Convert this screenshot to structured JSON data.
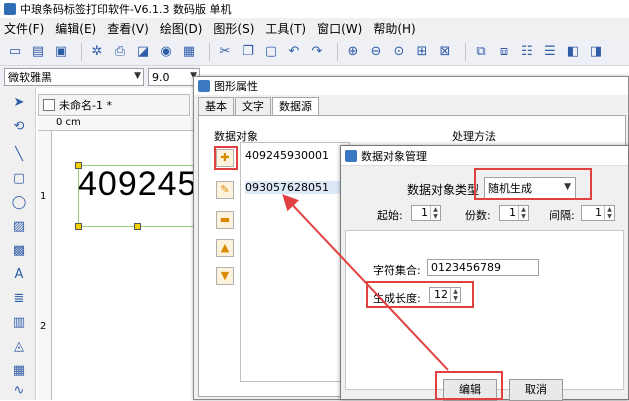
{
  "app": {
    "title": "中琅条码标签打印软件-V6.1.3 数码版 单机"
  },
  "menu": [
    "文件(F)",
    "编辑(E)",
    "查看(V)",
    "绘图(D)",
    "图形(S)",
    "工具(T)",
    "窗口(W)",
    "帮助(H)"
  ],
  "font_bar": {
    "font": "微软雅黑",
    "size": "9.0"
  },
  "document": {
    "tab_title": "未命名-1 *",
    "ruler_top": "0 cm",
    "ruler_marks": [
      "1",
      "2"
    ],
    "barcode_text": "409245"
  },
  "prop_window": {
    "title": "图形属性",
    "tabs": [
      "基本",
      "文字",
      "数据源"
    ],
    "objects_label": "数据对象",
    "method_label": "处理方法",
    "objects": [
      "409245930001",
      "093057628051"
    ]
  },
  "dialog": {
    "title": "数据对象管理",
    "type_label": "数据对象类型",
    "type_value": "随机生成",
    "start_label": "起始:",
    "start_value": "1",
    "copies_label": "份数:",
    "copies_value": "1",
    "interval_label": "间隔:",
    "interval_value": "1",
    "charset_label": "字符集合:",
    "charset_value": "0123456789",
    "length_label": "生成长度:",
    "length_value": "12",
    "edit_button": "编辑",
    "cancel_button": "取消"
  },
  "colors": {
    "highlight": "#e04040",
    "accent": "#2f5da8"
  }
}
